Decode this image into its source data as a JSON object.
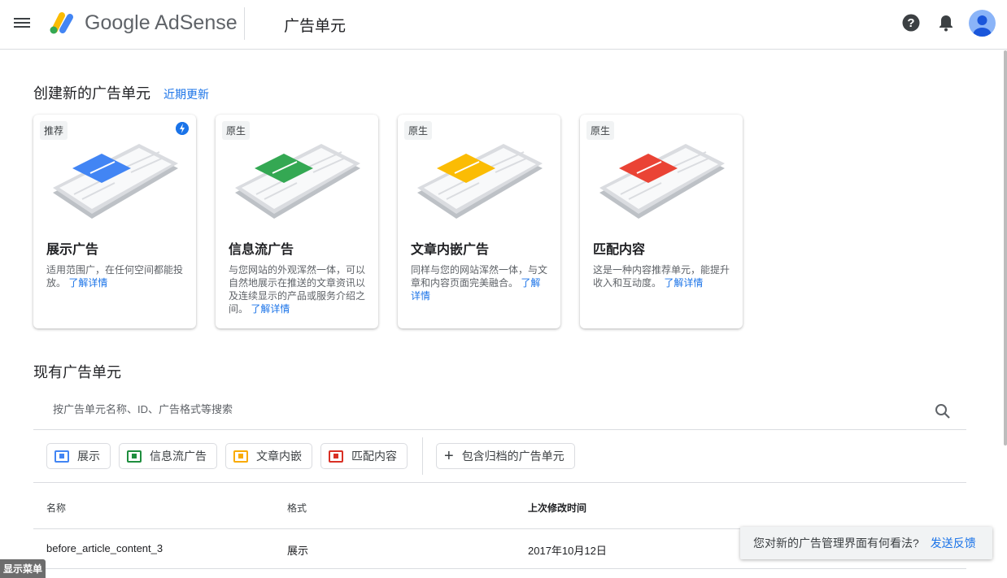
{
  "header": {
    "brand": "Google AdSense",
    "page_title": "广告单元",
    "icons": [
      "menu-icon",
      "help-icon",
      "bell-icon",
      "avatar"
    ]
  },
  "create": {
    "title": "创建新的广告单元",
    "recent_updates": "近期更新",
    "cards": [
      {
        "tag": "推荐",
        "title": "展示广告",
        "desc": "适用范围广，在任何空间都能投放。",
        "learn_more": "了解详情",
        "color": "#4285f4",
        "recommended": true
      },
      {
        "tag": "原生",
        "title": "信息流广告",
        "desc": "与您网站的外观浑然一体，可以自然地展示在推送的文章资讯以及连续显示的产品或服务介绍之间。",
        "learn_more": "了解详情",
        "color": "#34a853"
      },
      {
        "tag": "原生",
        "title": "文章内嵌广告",
        "desc": "同样与您的网站浑然一体，与文章和内容页面完美融合。",
        "learn_more": "了解详情",
        "color": "#fbbc04"
      },
      {
        "tag": "原生",
        "title": "匹配内容",
        "desc": "这是一种内容推荐单元，能提升收入和互动度。",
        "learn_more": "了解详情",
        "color": "#ea4335"
      }
    ]
  },
  "existing": {
    "title": "现有广告单元",
    "search_placeholder": "按广告单元名称、ID、广告格式等搜索",
    "filters": [
      {
        "label": "展示",
        "color": "#4285f4"
      },
      {
        "label": "信息流广告",
        "color": "#1e8e3e"
      },
      {
        "label": "文章内嵌",
        "color": "#f9ab00"
      },
      {
        "label": "匹配内容",
        "color": "#d93025"
      }
    ],
    "archived_label": "包含归档的广告单元",
    "columns": [
      "名称",
      "格式",
      "上次修改时间"
    ],
    "rows": [
      {
        "name": "before_article_content_3",
        "format": "展示",
        "modified": "2017年10月12日"
      }
    ]
  },
  "feedback": {
    "question": "您对新的广告管理界面有何看法?",
    "action": "发送反馈"
  },
  "show_menu": "显示菜单"
}
